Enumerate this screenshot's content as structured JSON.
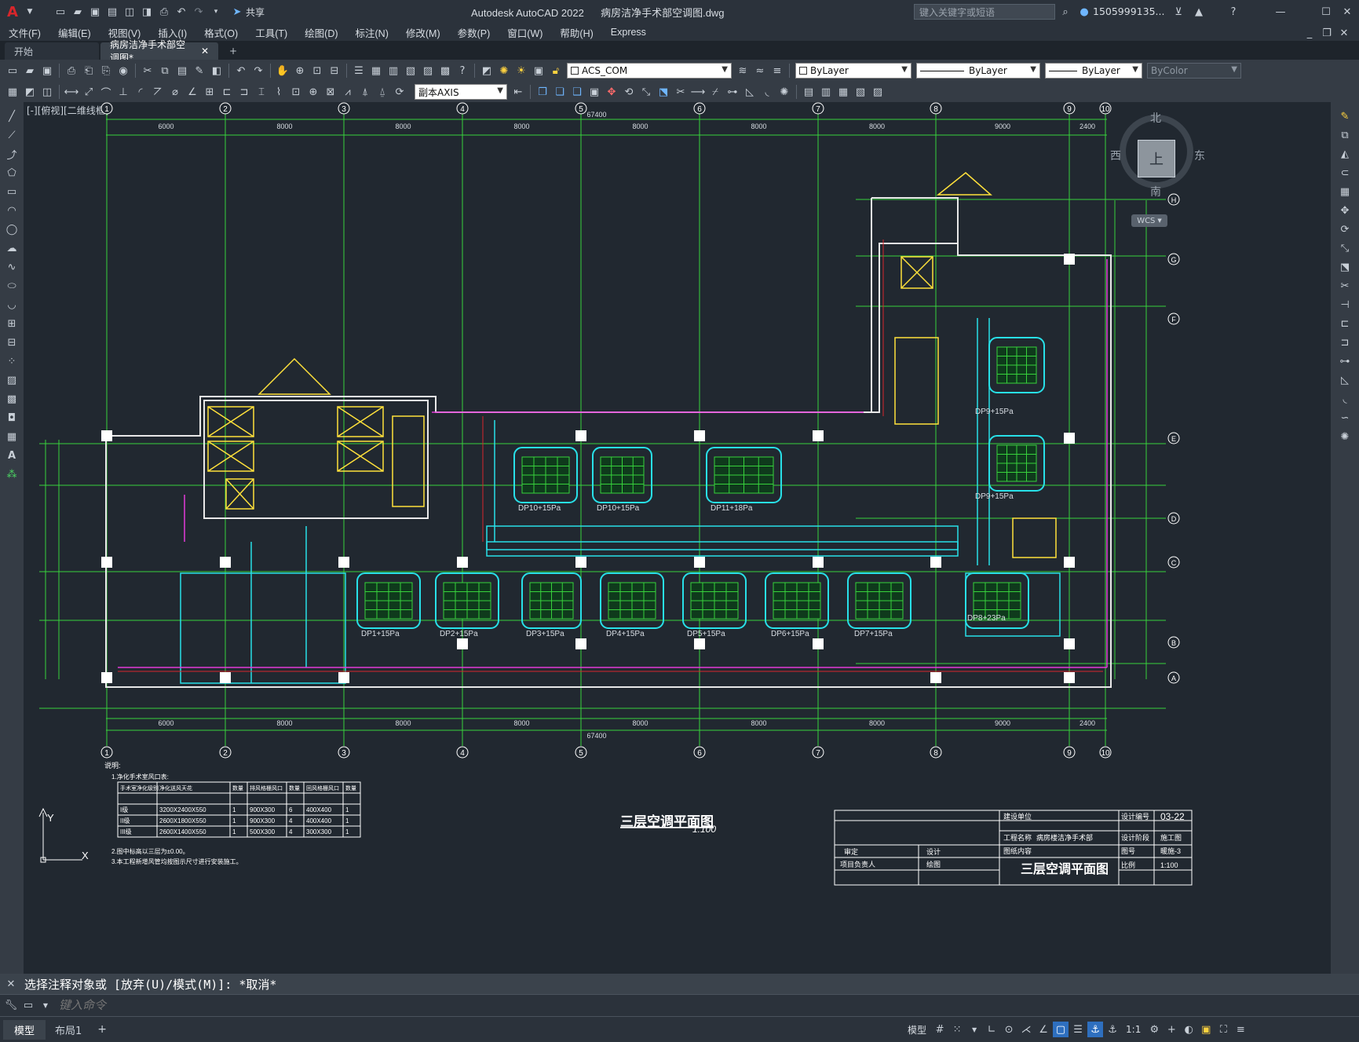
{
  "app": {
    "title": "Autodesk AutoCAD 2022",
    "file": "病房洁净手术部空调图.dwg",
    "search_placeholder": "键入关键字或短语",
    "user": "1505999135...",
    "accent_red": "#d8262b"
  },
  "menu": [
    "文件(F)",
    "编辑(E)",
    "视图(V)",
    "插入(I)",
    "格式(O)",
    "工具(T)",
    "绘图(D)",
    "标注(N)",
    "修改(M)",
    "参数(P)",
    "窗口(W)",
    "帮助(H)",
    "Express"
  ],
  "quick": {
    "share_label": "共享"
  },
  "tabs": {
    "start": "开始",
    "doc": "病房洁净手术部空调图*",
    "add": "+"
  },
  "toolbar": {
    "ucs": "ACS_COM",
    "layer1": "ByLayer",
    "linetype": "ByLayer",
    "lineweight": "ByLayer",
    "color": "ByColor",
    "dimstyle": "副本AXIS"
  },
  "viewport_label": "[-][俯视][二维线框]",
  "viewcube": {
    "n": "北",
    "s": "南",
    "e": "东",
    "w": "西",
    "face": "上",
    "wcs": "WCS"
  },
  "drawing": {
    "grid_nums": [
      "1",
      "2",
      "3",
      "4",
      "5",
      "6",
      "7",
      "8",
      "9",
      "10"
    ],
    "grid_letters": [
      "H",
      "G",
      "F",
      "E",
      "D",
      "C",
      "B",
      "A"
    ],
    "top_dims": [
      "6000",
      "8000",
      "8000",
      "8000",
      "8000",
      "8000",
      "8000",
      "9000",
      "2400"
    ],
    "total_dim": "67400",
    "rooms": [
      "DP1+15Pa",
      "DP2+15Pa",
      "DP3+15Pa",
      "DP4+15Pa",
      "DP5+15Pa",
      "DP6+15Pa",
      "DP7+15Pa",
      "DP8+23Pa",
      "DP9+15Pa",
      "DP10+15Pa",
      "DP11+18Pa"
    ],
    "plan_title": "三层空调平面图",
    "scale": "1:100",
    "notes_heading": "说明:",
    "notes": [
      "1.净化手术室风口表:",
      "2.图中标高以三层为±0.00。",
      "3.本工程新增风管均按图示尺寸进行安装施工。"
    ],
    "table": {
      "head": [
        "手术室净化级别",
        "净化送风天花",
        "数量",
        "排风格栅风口",
        "数量",
        "回风格栅风口",
        "数量"
      ],
      "rows": [
        [
          "I级",
          "3200X2400X550",
          "1",
          "900X300",
          "6",
          "400X400",
          "1"
        ],
        [
          "II级",
          "2600X1800X550",
          "1",
          "900X300",
          "4",
          "400X400",
          "1"
        ],
        [
          "III级",
          "2600X1400X550",
          "1",
          "500X300",
          "4",
          "300X300",
          "1"
        ]
      ]
    },
    "titleblock": {
      "build_unit": "建设单位",
      "project": "工程名称",
      "project_val": "病房楼洁净手术部",
      "drawing": "图纸内容",
      "design_no": "设计编号",
      "design_no_val": "03-22",
      "stage": "设计阶段",
      "stage_val": "施工图",
      "sheet": "图号",
      "sheet_val": "暖施-3",
      "scale_label": "比例",
      "scale_val": "1:100",
      "approve": "审定",
      "design": "设计",
      "pm": "项目负责人",
      "draw": "绘图",
      "title_big": "三层空调平面图"
    }
  },
  "command": {
    "history": "选择注释对象或 [放弃(U)/模式(M)]: *取消*",
    "placeholder": "键入命令"
  },
  "status": {
    "model": "模型",
    "layout1": "布局1",
    "add": "+",
    "model_right": "模型",
    "scale": "1:1"
  }
}
